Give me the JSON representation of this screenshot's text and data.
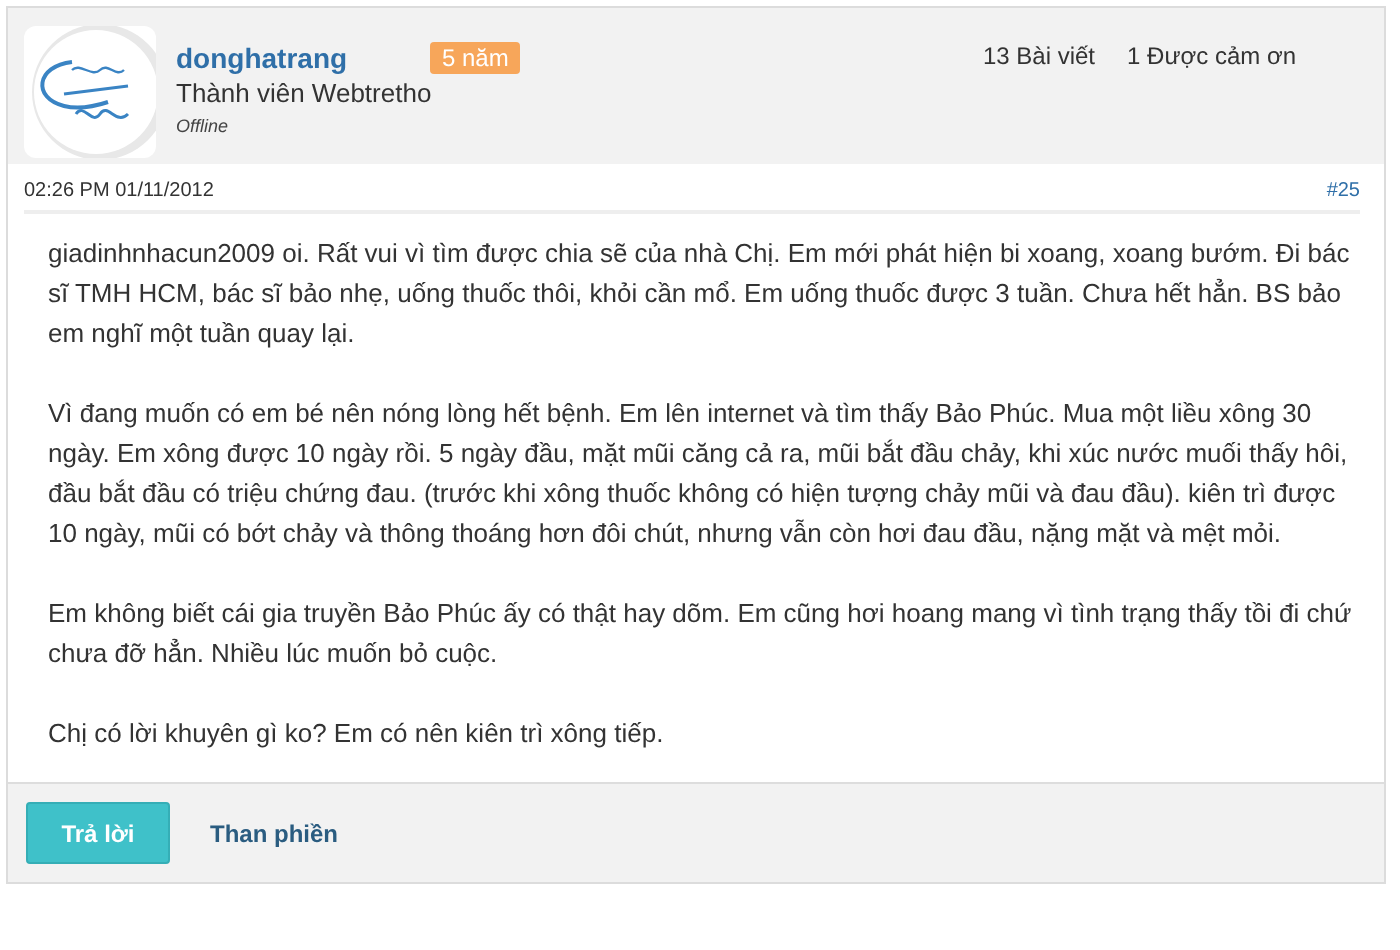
{
  "user": {
    "name": "donghatrang",
    "badge": "5 năm",
    "rank": "Thành viên Webtretho",
    "status": "Offline",
    "stats": [
      "13 Bài viết",
      "1 Được cảm ơn"
    ]
  },
  "post": {
    "time": "02:26 PM 01/11/2012",
    "number": "#25",
    "paragraphs": [
      "giadinhnhacun2009 oi. Rất vui vì tìm được chia sẽ của nhà Chị. Em mới phát hiện bi xoang, xoang bướm. Đi bác sĩ TMH HCM, bác sĩ bảo nhẹ, uống thuốc thôi, khỏi cần mổ. Em uống thuốc được 3 tuần. Chưa hết hẳn. BS bảo em nghĩ một tuần quay lại.",
      "Vì đang muốn có em bé nên nóng lòng hết bệnh. Em lên internet và tìm thấy Bảo Phúc. Mua một liều xông 30 ngày. Em xông được 10 ngày rồi. 5 ngày đầu, mặt mũi căng cả ra, mũi bắt đầu chảy, khi xúc nước muối thấy hôi, đầu bắt đầu có triệu chứng đau. (trước khi xông thuốc không có hiện tượng chảy mũi và đau đầu). kiên trì được 10 ngày, mũi có bớt chảy và thông thoáng hơn đôi chút, nhưng vẫn còn hơi đau đầu, nặng mặt và mệt mỏi.",
      "Em không biết cái gia truyền Bảo Phúc ấy có thật hay dõm. Em cũng hơi hoang mang vì tình trạng thấy tồi đi chứ chưa đỡ hẳn. Nhiều lúc muốn bỏ cuộc.",
      "Chị có lời khuyên gì ko? Em có nên kiên trì xông tiếp."
    ]
  },
  "actions": [
    {
      "kind": "primary",
      "label": "Trả lời"
    },
    {
      "kind": "link",
      "label": "Than phiền"
    }
  ]
}
